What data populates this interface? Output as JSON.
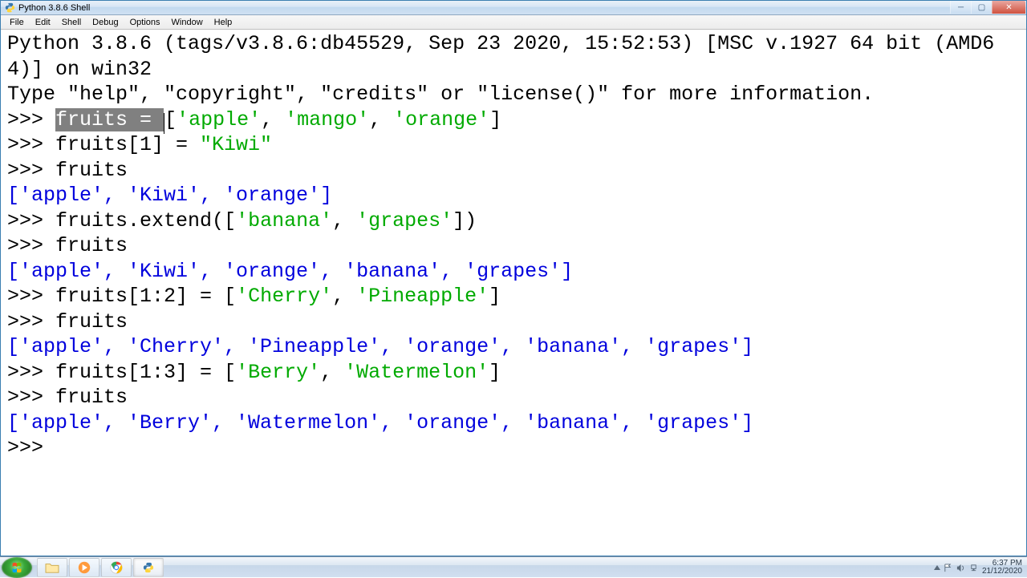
{
  "window": {
    "title": "Python 3.8.6 Shell"
  },
  "menu": {
    "items": [
      "File",
      "Edit",
      "Shell",
      "Debug",
      "Options",
      "Window",
      "Help"
    ]
  },
  "console": {
    "banner_line1": "Python 3.8.6 (tags/v3.8.6:db45529, Sep 23 2020, 15:52:53) [MSC v.1927 64 bit (AMD64)] on win32",
    "banner_line2": "Type \"help\", \"copyright\", \"credits\" or \"license()\" for more information.",
    "prompt": ">>> ",
    "lines": [
      {
        "type": "input",
        "segments": [
          {
            "cls": "sel",
            "text": "fruits = "
          },
          {
            "cls": "kw",
            "text": "["
          },
          {
            "cls": "str",
            "text": "'apple'"
          },
          {
            "cls": "kw",
            "text": ", "
          },
          {
            "cls": "str",
            "text": "'mango'"
          },
          {
            "cls": "kw",
            "text": ", "
          },
          {
            "cls": "str",
            "text": "'orange'"
          },
          {
            "cls": "kw",
            "text": "]"
          }
        ]
      },
      {
        "type": "input",
        "segments": [
          {
            "cls": "kw",
            "text": "fruits[1] = "
          },
          {
            "cls": "str",
            "text": "\"Kiwi\""
          }
        ]
      },
      {
        "type": "input",
        "segments": [
          {
            "cls": "kw",
            "text": "fruits"
          }
        ]
      },
      {
        "type": "output",
        "text": "['apple', 'Kiwi', 'orange']"
      },
      {
        "type": "input",
        "segments": [
          {
            "cls": "kw",
            "text": "fruits.extend(["
          },
          {
            "cls": "str",
            "text": "'banana'"
          },
          {
            "cls": "kw",
            "text": ", "
          },
          {
            "cls": "str",
            "text": "'grapes'"
          },
          {
            "cls": "kw",
            "text": "])"
          }
        ]
      },
      {
        "type": "input",
        "segments": [
          {
            "cls": "kw",
            "text": "fruits"
          }
        ]
      },
      {
        "type": "output",
        "text": "['apple', 'Kiwi', 'orange', 'banana', 'grapes']"
      },
      {
        "type": "input",
        "segments": [
          {
            "cls": "kw",
            "text": "fruits[1:2] = ["
          },
          {
            "cls": "str",
            "text": "'Cherry'"
          },
          {
            "cls": "kw",
            "text": ", "
          },
          {
            "cls": "str",
            "text": "'Pineapple'"
          },
          {
            "cls": "kw",
            "text": "]"
          }
        ]
      },
      {
        "type": "input",
        "segments": [
          {
            "cls": "kw",
            "text": "fruits"
          }
        ]
      },
      {
        "type": "output",
        "text": "['apple', 'Cherry', 'Pineapple', 'orange', 'banana', 'grapes']"
      },
      {
        "type": "input",
        "segments": [
          {
            "cls": "kw",
            "text": "fruits[1:3] = ["
          },
          {
            "cls": "str",
            "text": "'Berry'"
          },
          {
            "cls": "kw",
            "text": ", "
          },
          {
            "cls": "str",
            "text": "'Watermelon'"
          },
          {
            "cls": "kw",
            "text": "]"
          }
        ]
      },
      {
        "type": "input",
        "segments": [
          {
            "cls": "kw",
            "text": "fruits"
          }
        ]
      },
      {
        "type": "output",
        "text": "['apple', 'Berry', 'Watermelon', 'orange', 'banana', 'grapes']"
      },
      {
        "type": "input",
        "segments": []
      }
    ]
  },
  "taskbar": {
    "time": "6:37 PM",
    "date": "21/12/2020"
  }
}
